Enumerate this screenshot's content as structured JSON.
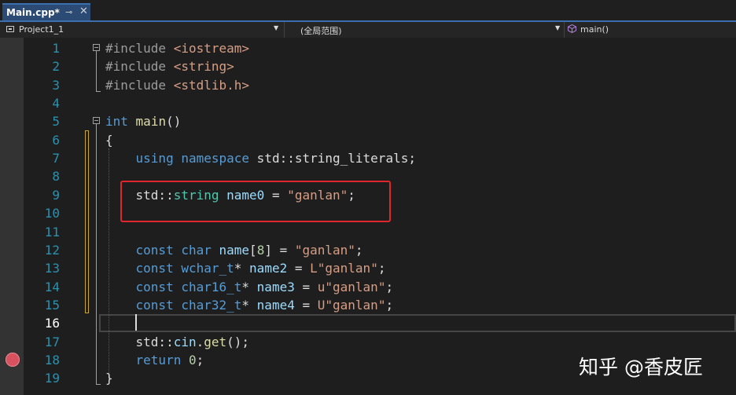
{
  "tab": {
    "title": "Main.cpp*",
    "pin_glyph": "⊸",
    "close_glyph": "✕"
  },
  "nav": {
    "project": "Project1_1",
    "scope": "(全局范围)",
    "member": "main()"
  },
  "editor": {
    "current_line": 16,
    "breakpoint_line": 18,
    "line_numbers": [
      "1",
      "2",
      "3",
      "4",
      "5",
      "6",
      "7",
      "8",
      "9",
      "10",
      "11",
      "12",
      "13",
      "14",
      "15",
      "16",
      "17",
      "18",
      "19"
    ],
    "lines": [
      [
        {
          "t": "#include ",
          "c": "pp"
        },
        {
          "t": "<iostream>",
          "c": "inc"
        }
      ],
      [
        {
          "t": "#include ",
          "c": "pp"
        },
        {
          "t": "<string>",
          "c": "inc"
        }
      ],
      [
        {
          "t": "#include ",
          "c": "pp"
        },
        {
          "t": "<stdlib.h>",
          "c": "inc"
        }
      ],
      [],
      [
        {
          "t": "int",
          "c": "kw"
        },
        {
          "t": " "
        },
        {
          "t": "main",
          "c": "fn"
        },
        {
          "t": "()"
        }
      ],
      [
        {
          "t": "{"
        }
      ],
      [
        {
          "t": "    "
        },
        {
          "t": "using",
          "c": "kw"
        },
        {
          "t": " "
        },
        {
          "t": "namespace",
          "c": "kw"
        },
        {
          "t": " std::string_literals;"
        }
      ],
      [],
      [
        {
          "t": "    std::"
        },
        {
          "t": "string",
          "c": "ty"
        },
        {
          "t": " "
        },
        {
          "t": "name0",
          "c": "var"
        },
        {
          "t": " = "
        },
        {
          "t": "\"ganlan\"",
          "c": "str"
        },
        {
          "t": ";"
        }
      ],
      [],
      [],
      [
        {
          "t": "    "
        },
        {
          "t": "const",
          "c": "kw"
        },
        {
          "t": " "
        },
        {
          "t": "char",
          "c": "kw"
        },
        {
          "t": " "
        },
        {
          "t": "name",
          "c": "var"
        },
        {
          "t": "["
        },
        {
          "t": "8",
          "c": "num"
        },
        {
          "t": "] = "
        },
        {
          "t": "\"ganlan\"",
          "c": "str"
        },
        {
          "t": ";"
        }
      ],
      [
        {
          "t": "    "
        },
        {
          "t": "const",
          "c": "kw"
        },
        {
          "t": " "
        },
        {
          "t": "wchar_t",
          "c": "kw"
        },
        {
          "t": "* "
        },
        {
          "t": "name2",
          "c": "var"
        },
        {
          "t": " = "
        },
        {
          "t": "L\"ganlan\"",
          "c": "str"
        },
        {
          "t": ";"
        }
      ],
      [
        {
          "t": "    "
        },
        {
          "t": "const",
          "c": "kw"
        },
        {
          "t": " "
        },
        {
          "t": "char16_t",
          "c": "kw"
        },
        {
          "t": "* "
        },
        {
          "t": "name3",
          "c": "var"
        },
        {
          "t": " = "
        },
        {
          "t": "u\"ganlan\"",
          "c": "str"
        },
        {
          "t": ";"
        }
      ],
      [
        {
          "t": "    "
        },
        {
          "t": "const",
          "c": "kw"
        },
        {
          "t": " "
        },
        {
          "t": "char32_t",
          "c": "kw"
        },
        {
          "t": "* "
        },
        {
          "t": "name4",
          "c": "var"
        },
        {
          "t": " = "
        },
        {
          "t": "U\"ganlan\"",
          "c": "str"
        },
        {
          "t": ";"
        }
      ],
      [],
      [
        {
          "t": "    std::"
        },
        {
          "t": "cin",
          "c": "var"
        },
        {
          "t": "."
        },
        {
          "t": "get",
          "c": "fn"
        },
        {
          "t": "();"
        }
      ],
      [
        {
          "t": "    "
        },
        {
          "t": "return",
          "c": "kw"
        },
        {
          "t": " "
        },
        {
          "t": "0",
          "c": "num"
        },
        {
          "t": ";"
        }
      ],
      [
        {
          "t": "}"
        }
      ]
    ]
  },
  "watermark": "知乎 @香皮匠",
  "colors": {
    "accent": "#3c6fb0",
    "highlight_box": "#e0262c",
    "breakpoint": "#d8515e"
  }
}
